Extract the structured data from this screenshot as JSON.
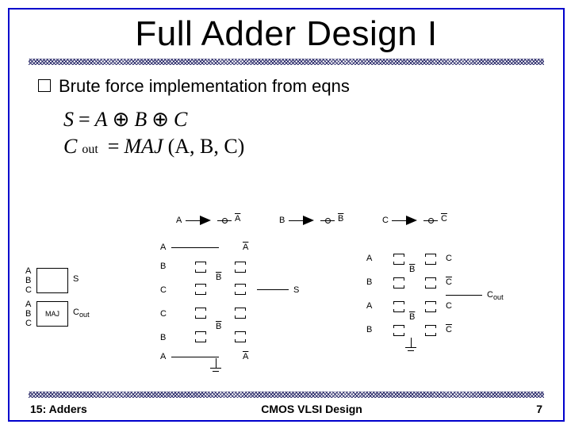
{
  "title": "Full Adder Design I",
  "bullet": "Brute force implementation from eqns",
  "equations": {
    "sum_lhs": "S",
    "sum_rhs_a": "A",
    "sum_rhs_b": "B",
    "sum_rhs_c": "C",
    "xor": "⊕",
    "eq": "=",
    "cout_lhs": "C",
    "cout_sub": "out",
    "maj": "MAJ",
    "cout_args": "(A, B, C)"
  },
  "symbolic": {
    "inputs_block": {
      "A": "A",
      "B": "B",
      "C": "C",
      "S": "S",
      "Cout": "C",
      "Cout_sub": "out",
      "MAJ": "MAJ"
    },
    "inverters": [
      {
        "in": "A",
        "out": "A",
        "out_bar": true
      },
      {
        "in": "B",
        "out": "B",
        "out_bar": true
      },
      {
        "in": "C",
        "out": "C",
        "out_bar": true
      }
    ],
    "sum_net_labels": {
      "A": "A",
      "B": "B",
      "C": "C",
      "S": "S",
      "Bbar": "B",
      "Abar": "A"
    },
    "cout_net_labels": {
      "A": "A",
      "B": "B",
      "C": "C",
      "Cout": "C",
      "Cout_sub": "out",
      "Bbar": "B",
      "Cbar": "C"
    }
  },
  "footer": {
    "left": "15: Adders",
    "center": "CMOS VLSI Design",
    "right": "7"
  }
}
